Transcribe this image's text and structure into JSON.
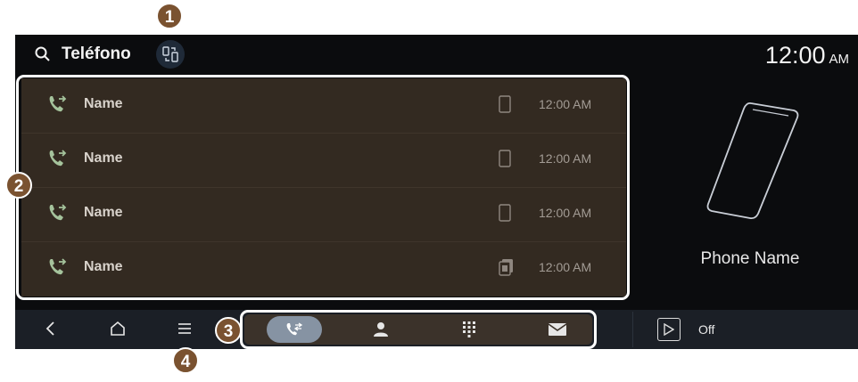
{
  "header": {
    "title": "Teléfono",
    "clock_time": "12:00",
    "clock_ampm": "AM"
  },
  "call_log": [
    {
      "name": "Name",
      "device": "phone-icon",
      "time": "12:00 AM"
    },
    {
      "name": "Name",
      "device": "phone-icon",
      "time": "12:00 AM"
    },
    {
      "name": "Name",
      "device": "phone-icon",
      "time": "12:00 AM"
    },
    {
      "name": "Name",
      "device": "sim-card-icon",
      "time": "12:00 AM"
    }
  ],
  "phone_panel": {
    "phone_name": "Phone Name"
  },
  "bottom_bar": {
    "tabs": [
      "recent-calls-icon",
      "contacts-icon",
      "keypad-icon",
      "messages-icon"
    ],
    "active_tab": "recent-calls-icon",
    "media_status": "Off"
  },
  "callouts": [
    "1",
    "2",
    "3",
    "4"
  ],
  "colors": {
    "list_bg": "#332a21",
    "active_tab": "#8693a3",
    "badge": "#7a5230",
    "screen_bg": "#0b0c0e"
  }
}
